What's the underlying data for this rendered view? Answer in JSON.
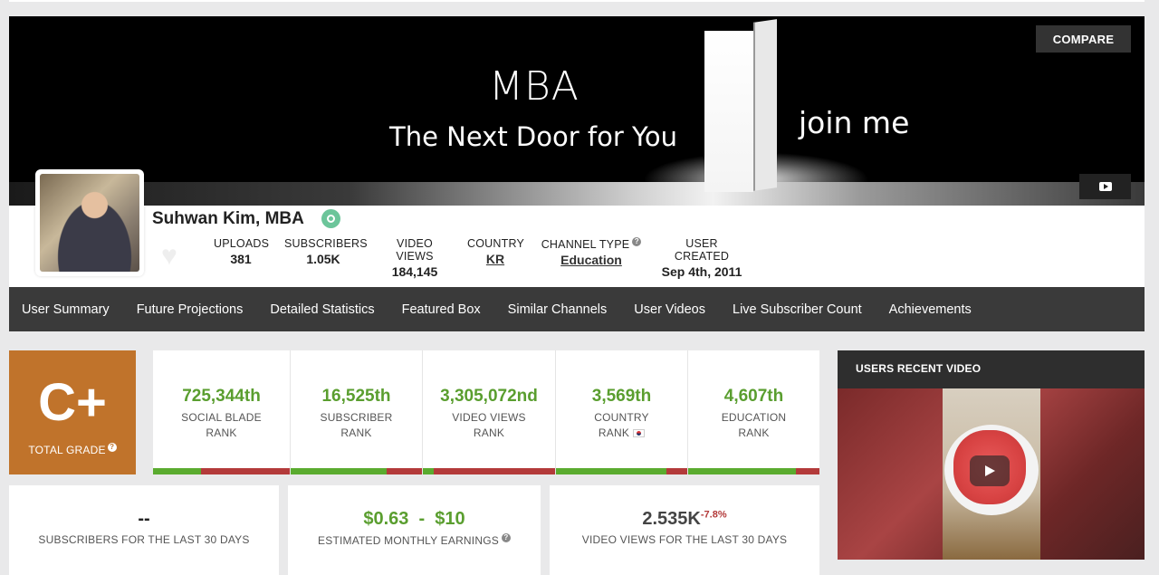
{
  "banner": {
    "line1": "MBA",
    "line2": "The Next Door for You",
    "line3": "join me",
    "compare_label": "COMPARE",
    "youtube_icon": "youtube-icon"
  },
  "profile": {
    "name": "Suhwan Kim, MBA",
    "verified_icon": "verified-icon",
    "stats": {
      "uploads_label": "UPLOADS",
      "uploads_value": "381",
      "subscribers_label": "SUBSCRIBERS",
      "subscribers_value": "1.05K",
      "views_label": "VIDEO VIEWS",
      "views_value": "184,145",
      "country_label": "COUNTRY",
      "country_value": "KR",
      "channel_type_label": "CHANNEL TYPE",
      "channel_type_value": "Education",
      "created_label": "USER CREATED",
      "created_value": "Sep 4th, 2011"
    }
  },
  "nav": {
    "items": [
      "User Summary",
      "Future Projections",
      "Detailed Statistics",
      "Featured Box",
      "Similar Channels",
      "User Videos",
      "Live Subscriber Count",
      "Achievements"
    ]
  },
  "grade": {
    "value": "C+",
    "label": "TOTAL GRADE",
    "color": "#c0732b"
  },
  "ranks": [
    {
      "value": "725,344th",
      "line1": "SOCIAL BLADE",
      "line2": "RANK",
      "bar_fill": 0.35
    },
    {
      "value": "16,525th",
      "line1": "SUBSCRIBER",
      "line2": "RANK",
      "bar_fill": 0.73
    },
    {
      "value": "3,305,072nd",
      "line1": "VIDEO VIEWS",
      "line2": "RANK",
      "bar_fill": 0.08
    },
    {
      "value": "3,569th",
      "line1": "COUNTRY",
      "line2": "RANK",
      "bar_fill": 0.84
    },
    {
      "value": "4,607th",
      "line1": "EDUCATION",
      "line2": "RANK",
      "bar_fill": 0.82
    }
  ],
  "summary": {
    "subs_value": "--",
    "subs_label": "SUBSCRIBERS FOR THE LAST 30 DAYS",
    "earnings_value": "$0.63  -  $10",
    "earnings_label": "ESTIMATED MONTHLY EARNINGS",
    "views_value": "2.535K",
    "views_delta": "-7.8%",
    "views_label": "VIDEO VIEWS FOR THE LAST 30 DAYS"
  },
  "recent_video": {
    "title": "USERS RECENT VIDEO"
  },
  "colors": {
    "rank_green": "#5a9e2f",
    "bar_red": "#b33a3a",
    "nav_bg": "#3a3a3a",
    "verified": "#6cc59a"
  }
}
